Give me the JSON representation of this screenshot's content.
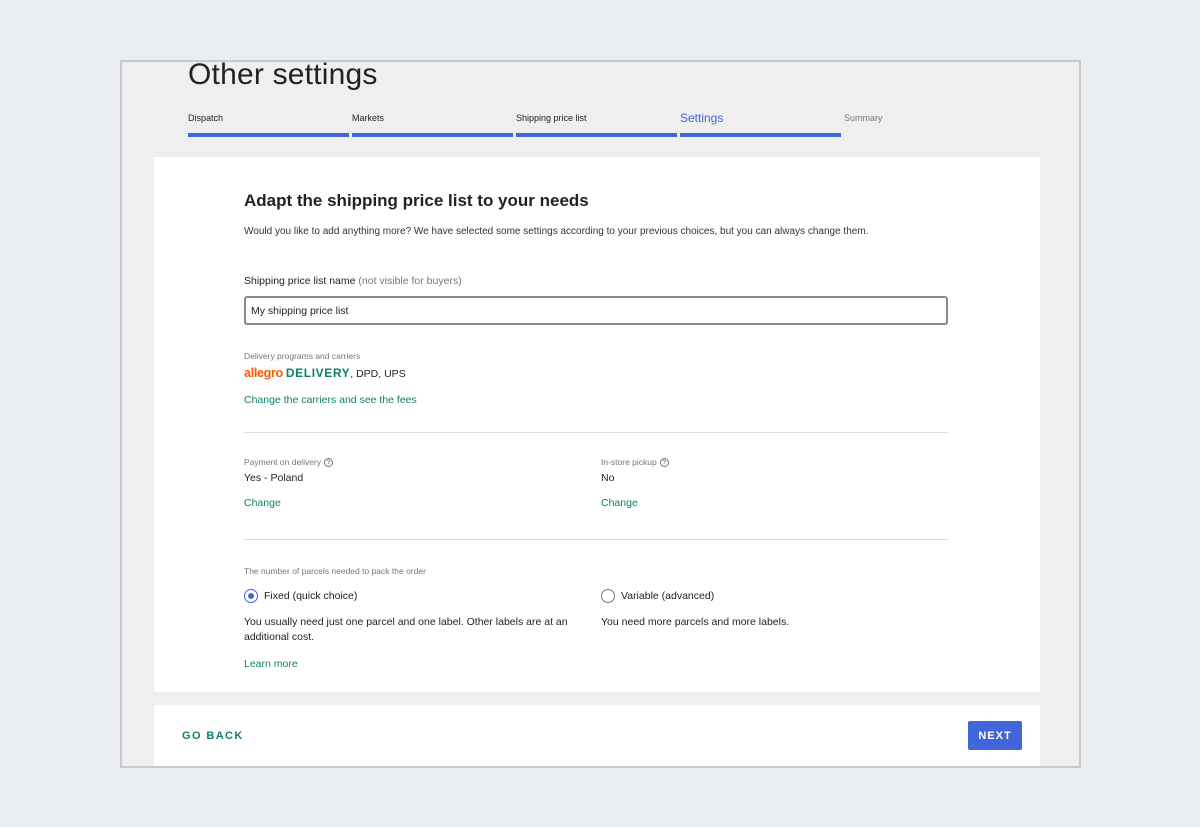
{
  "page": {
    "title": "Other settings"
  },
  "steps": [
    {
      "label": "Dispatch",
      "state": "done"
    },
    {
      "label": "Markets",
      "state": "done"
    },
    {
      "label": "Shipping price list",
      "state": "done"
    },
    {
      "label": "Settings",
      "state": "active"
    },
    {
      "label": "Summary",
      "state": "todo"
    }
  ],
  "form": {
    "heading": "Adapt the shipping price list to your needs",
    "intro": "Would you like to add anything more? We have selected some settings according to your previous choices, but you can always change them.",
    "name_label": "Shipping price list name",
    "name_hint": "(not visible for buyers)",
    "name_value": "My shipping price list",
    "delivery": {
      "label": "Delivery programs and carriers",
      "logo_allegro": "allegro",
      "logo_delivery": "DELIVERY",
      "carriers_rest": ", DPD, UPS",
      "change_link": "Change the carriers and see the fees"
    },
    "payment": {
      "label": "Payment on delivery",
      "value": "Yes - Poland",
      "change_link": "Change"
    },
    "pickup": {
      "label": "In-store pickup",
      "value": "No",
      "change_link": "Change"
    },
    "parcels": {
      "label": "The number of parcels needed to pack the order",
      "fixed_label": "Fixed (quick choice)",
      "fixed_desc": "You usually need just one parcel and one label. Other labels are at an additional cost.",
      "learn_more": "Learn more",
      "variable_label": "Variable (advanced)",
      "variable_desc": "You need more parcels and more labels.",
      "selected": "fixed"
    },
    "help_icon_glyph": "?"
  },
  "footer": {
    "back_label": "GO BACK",
    "next_label": "NEXT"
  },
  "colors": {
    "accent_blue": "#4166d9",
    "link_green": "#10806b",
    "allegro_orange": "#ff5a00"
  }
}
